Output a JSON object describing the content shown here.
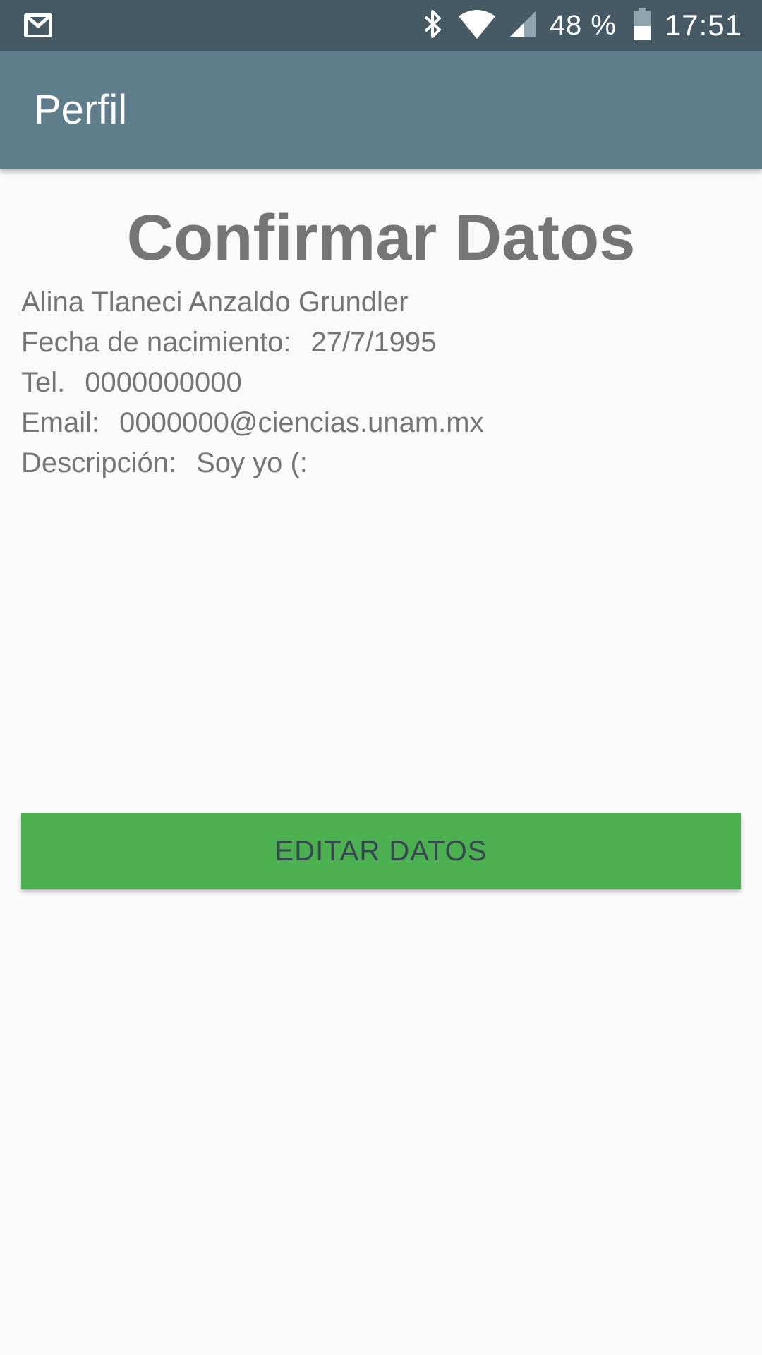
{
  "status_bar": {
    "notification_icon": "gmail-icon",
    "bluetooth_icon": "bluetooth-icon",
    "wifi_icon": "wifi-icon",
    "signal_icon": "cell-signal-icon",
    "battery_icon": "battery-icon",
    "battery_percent": "48 %",
    "battery_level": 0.48,
    "time": "17:51"
  },
  "app_bar": {
    "title": "Perfil",
    "color": "#607d8b"
  },
  "main": {
    "heading": "Confirmar Datos",
    "full_name": "Alina Tlaneci Anzaldo Grundler",
    "birthdate_label": "Fecha de nacimiento:",
    "birthdate_value": "27/7/1995",
    "phone_label": "Tel.",
    "phone_value": "0000000000",
    "email_label": "Email:",
    "email_value": "0000000@ciencias.unam.mx",
    "description_label": "Descripción:",
    "description_value": "Soy yo (:"
  },
  "actions": {
    "edit_button_label": "EDITAR DATOS",
    "edit_button_color": "#4caf50"
  },
  "colors": {
    "status_bar": "#455a64",
    "text_secondary": "#757575",
    "background": "#fafafa"
  }
}
